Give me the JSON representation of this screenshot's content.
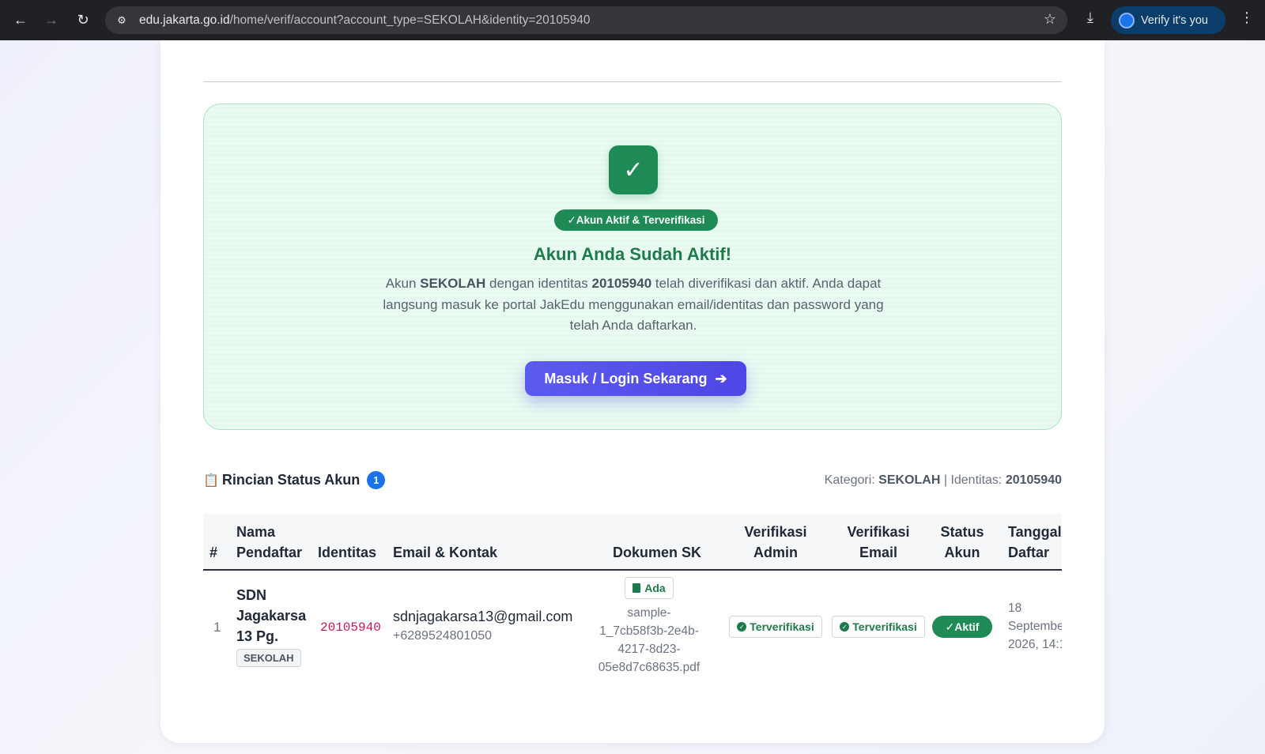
{
  "browser": {
    "url_host": "edu.jakarta.go.id",
    "url_path": "/home/verif/account?account_type=SEKOLAH&identity=20105940",
    "verify_label": "Verify it's you"
  },
  "success": {
    "check_glyph": "✓",
    "status_pill": "✓Akun Aktif & Terverifikasi",
    "title": "Akun Anda Sudah Aktif!",
    "desc_prefix": "Akun ",
    "desc_type": "SEKOLAH",
    "desc_mid": " dengan identitas ",
    "desc_identity": "20105940",
    "desc_suffix": " telah diverifikasi dan aktif. Anda dapat langsung masuk ke portal JakEdu menggunakan email/identitas dan password yang telah Anda daftarkan.",
    "login_label": "Masuk / Login Sekarang",
    "login_arrow": "➔"
  },
  "details": {
    "title": "Rincian Status Akun",
    "count": "1",
    "meta_cat_label": "Kategori: ",
    "meta_cat_value": "SEKOLAH",
    "meta_sep": " | Identitas: ",
    "meta_id_value": "20105940"
  },
  "table": {
    "headers": {
      "num": "#",
      "name_1": "Nama",
      "name_2": "Pendaftar",
      "identity": "Identitas",
      "email": "Email & Kontak",
      "doc": "Dokumen SK",
      "admin_1": "Verifikasi",
      "admin_2": "Admin",
      "emailv_1": "Verifikasi",
      "emailv_2": "Email",
      "status_1": "Status",
      "status_2": "Akun",
      "date_1": "Tanggal",
      "date_2": "Daftar"
    },
    "rows": [
      {
        "num": "1",
        "name_1": "SDN",
        "name_2": "Jagakarsa",
        "name_3": "13 Pg.",
        "category": "SEKOLAH",
        "identity": "20105940",
        "email": "sdnjagakarsa13@gmail.com",
        "phone": "+6289524801050",
        "doc_badge": "Ada",
        "doc_file_1": "sample-",
        "doc_file_2": "1_7cb58f3b-2e4b-",
        "doc_file_3": "4217-8d23-",
        "doc_file_4": "05e8d7c68635.pdf",
        "admin_verif": "Terverifikasi",
        "email_verif": "Terverifikasi",
        "status": "✓Aktif",
        "date_1": "18",
        "date_2": "September",
        "date_3": "2026, 14:1"
      }
    ]
  },
  "colors": {
    "brand_green": "#1e8a55",
    "button_indigo": "#4f46e5",
    "badge_blue": "#1a73e8"
  }
}
